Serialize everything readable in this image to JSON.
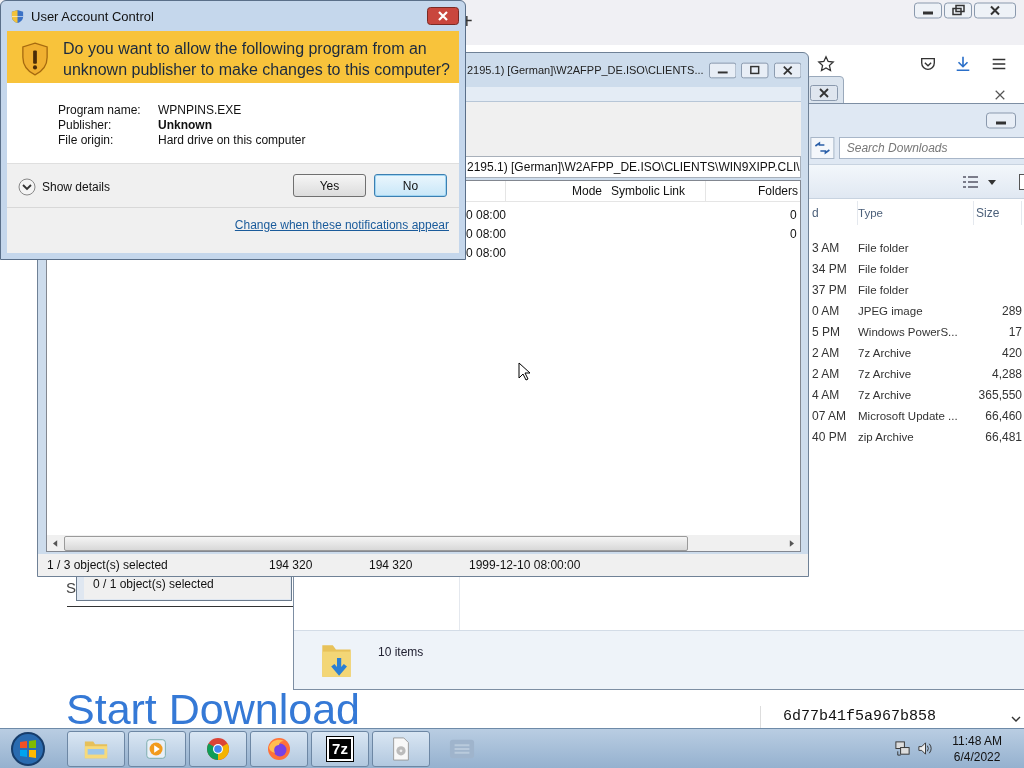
{
  "browser": {
    "new_tab": "+",
    "page": {
      "partial_letter": "S",
      "heading": "Start Download",
      "hash": "6d77b41f5a967b858"
    }
  },
  "back_window": {
    "status": "0 / 1 object(s) selected"
  },
  "explorer": {
    "search": {
      "placeholder": "Search Downloads"
    },
    "columns": [
      "d",
      "Type",
      "Size"
    ],
    "rows": [
      {
        "date": "3 AM",
        "type": "File folder"
      },
      {
        "date": "34 PM",
        "type": "File folder"
      },
      {
        "date": "37 PM",
        "type": "File folder"
      },
      {
        "date": "0 AM",
        "type": "JPEG image",
        "size": "289"
      },
      {
        "date": "5 PM",
        "type": "Windows PowerS...",
        "size": "17"
      },
      {
        "date": "2 AM",
        "type": "7z Archive",
        "size": "420"
      },
      {
        "date": "2 AM",
        "type": "7z Archive",
        "size": "4,288"
      },
      {
        "date": "4 AM",
        "type": "7z Archive",
        "size": "365,550"
      },
      {
        "date": "07 AM",
        "type": "Microsoft Update ...",
        "size": "66,460"
      },
      {
        "date": "40 PM",
        "type": "zip Archive",
        "size": "66,481"
      }
    ],
    "details": "10 items"
  },
  "archive_window": {
    "title": "2195.1) [German]\\W2AFPP_DE.ISO\\CLIENTS...",
    "path": "2195.1) [German]\\W2AFPP_DE.ISO\\CLIENTS\\WIN9XIPP.CLI\\",
    "columns": [
      "Mode",
      "Symbolic Link",
      "Folders"
    ],
    "rows": [
      {
        "modified": "0 08:00",
        "folders": "0"
      },
      {
        "modified": "0 08:00",
        "folders": "0"
      },
      {
        "modified": "0 08:00"
      }
    ],
    "status": [
      "1 / 3 object(s) selected",
      "194 320",
      "194 320",
      "1999-12-10 08:00:00"
    ]
  },
  "uac": {
    "title": "User Account Control",
    "question": "Do you want to allow the following program from an unknown publisher to make changes to this computer?",
    "fields": [
      {
        "label": "Program name:",
        "value": "WPNPINS.EXE",
        "bold": false
      },
      {
        "label": "Publisher:",
        "value": "Unknown",
        "bold": true
      },
      {
        "label": "File origin:",
        "value": "Hard drive on this computer",
        "bold": false
      }
    ],
    "details_toggle": "Show details",
    "expanded": false,
    "buttons": [
      {
        "label": "Yes",
        "selected": false
      },
      {
        "label": "No",
        "selected": true
      }
    ],
    "link": "Change when these notifications appear"
  },
  "taskbar": {
    "apps": [
      {
        "kind": "explorer"
      },
      {
        "kind": "media"
      },
      {
        "kind": "chrome"
      },
      {
        "kind": "firefox"
      },
      {
        "kind": "sevenzip",
        "label": "7z"
      },
      {
        "kind": "file"
      },
      {
        "kind": "faded"
      }
    ],
    "time": "11:48 AM",
    "date": "6/4/2022"
  }
}
